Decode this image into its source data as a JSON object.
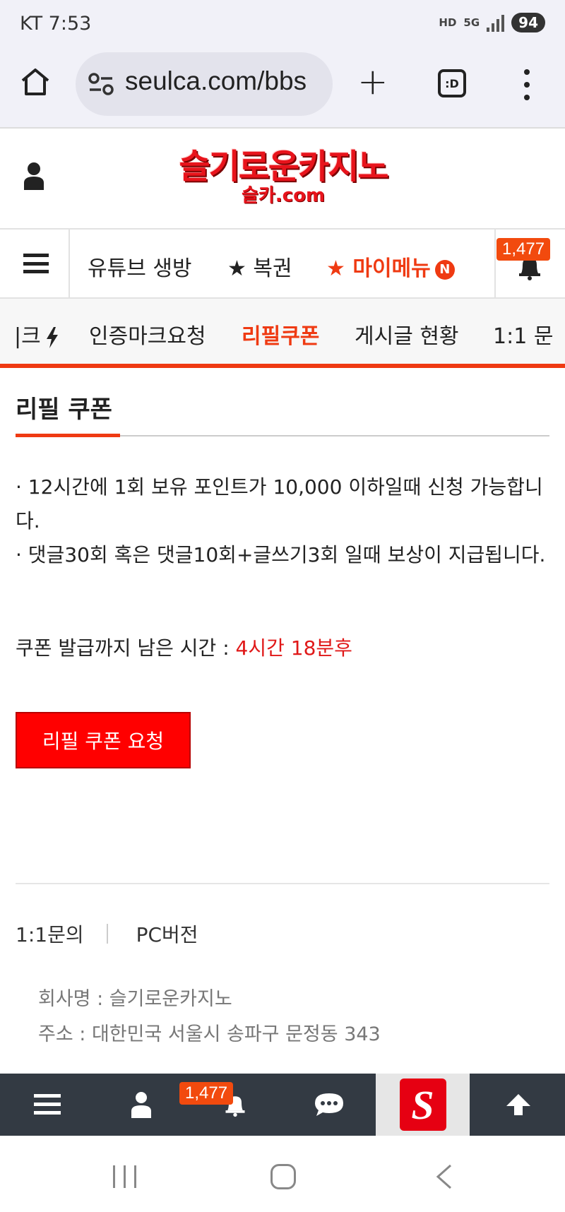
{
  "status_bar": {
    "carrier_time": "KT 7:53",
    "hd_label": "HD",
    "network_label": "5G",
    "battery": "94"
  },
  "browser": {
    "url": "seulca.com/bbs",
    "tabs_label": ":D"
  },
  "site": {
    "logo_main": "슬기로운카지노",
    "logo_sub": "슬카.com"
  },
  "main_nav": {
    "items": [
      {
        "label": "유튜브 생방"
      },
      {
        "label": "★ 복권"
      },
      {
        "label": "★ 마이메뉴"
      }
    ],
    "new_badge": "N",
    "notification_count": "1,477"
  },
  "sub_nav": {
    "items": [
      {
        "label": "|크"
      },
      {
        "label": "인증마크요청"
      },
      {
        "label": "리필쿠폰"
      },
      {
        "label": "게시글 현황"
      },
      {
        "label": "1:1 문"
      }
    ]
  },
  "content": {
    "title": "리필 쿠폰",
    "notice_line1": "· 12시간에 1회 보유 포인트가 10,000 이하일때 신청 가능합니다.",
    "notice_line2": "· 댓글30회 혹은 댓글10회+글쓰기3회 일때 보상이 지급됩니다.",
    "countdown_label": "쿠폰 발급까지 남은 시간 : ",
    "countdown_value": "4시간 18분후",
    "request_button": "리필 쿠폰 요청"
  },
  "footer": {
    "links": [
      {
        "label": "1:1문의"
      },
      {
        "label": "PC버전"
      }
    ],
    "company": "회사명 : 슬기로운카지노",
    "address": "주소 : 대한민국 서울시 송파구 문정동 343"
  },
  "bottom_bar": {
    "notification_count": "1,477",
    "logo_letter": "S"
  },
  "colors": {
    "accent": "#ef3a12",
    "button_red": "#ff0000",
    "countdown_red": "#e01818",
    "bottom_bar": "#333a43"
  }
}
